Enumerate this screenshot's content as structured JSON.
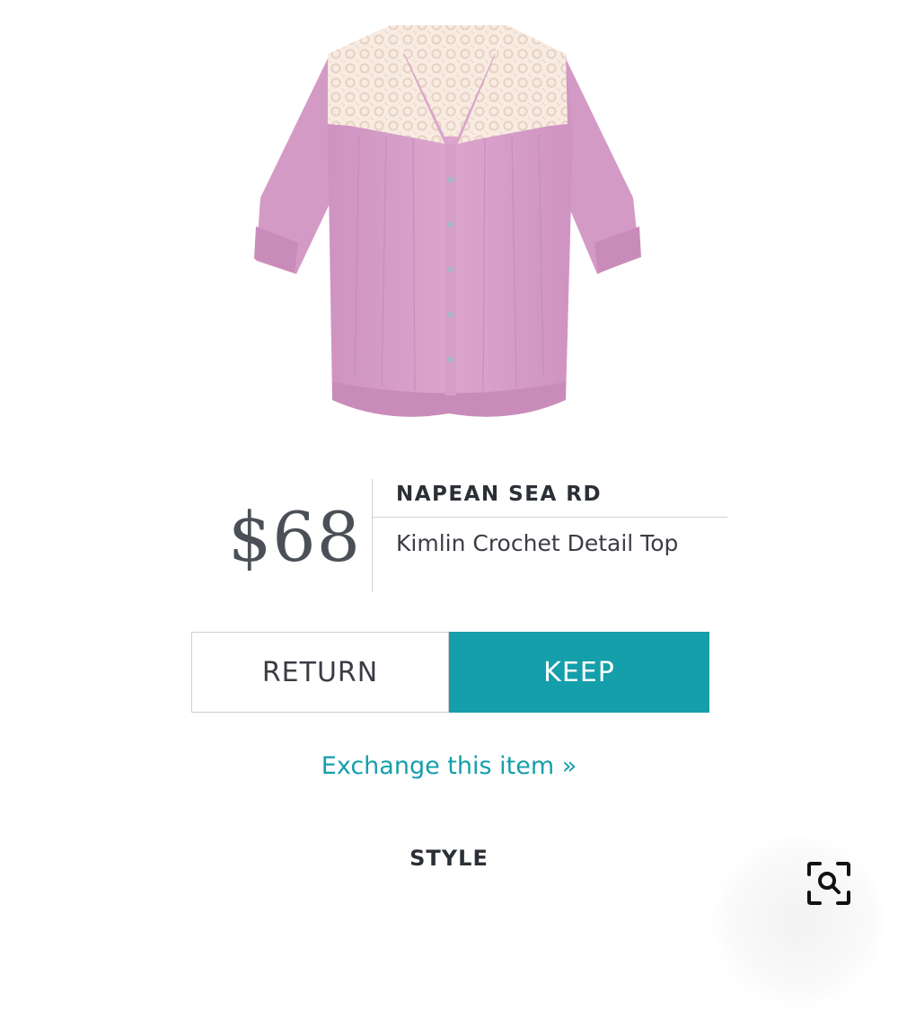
{
  "product": {
    "price": "$68",
    "brand": "NAPEAN SEA RD",
    "name": "Kimlin Crochet Detail Top",
    "image_icon": "blouse-product-image"
  },
  "actions": {
    "return_label": "RETURN",
    "keep_label": "KEEP",
    "exchange_label": "Exchange this item »"
  },
  "sections": {
    "style_heading": "STYLE"
  },
  "icons": {
    "zoom": "zoom-search-icon"
  },
  "colors": {
    "accent": "#149faa",
    "text_dark": "#2b2f36",
    "price": "#4b4f57",
    "blouse": "#d9a0cb",
    "crochet": "#f5e6dc"
  }
}
